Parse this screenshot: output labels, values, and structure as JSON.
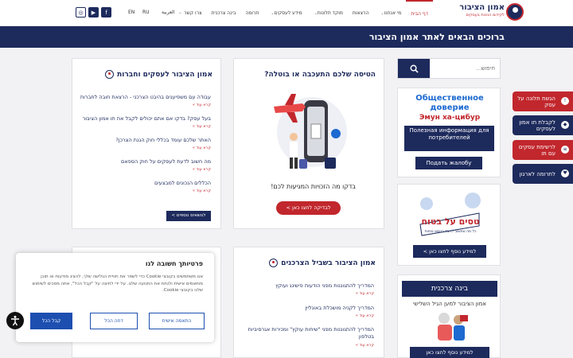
{
  "colors": {
    "navy": "#1d2a5c",
    "red": "#c1272d",
    "blue_button": "#1d4fb0"
  },
  "logo": {
    "title": "אמון הציבור",
    "subtitle": "לקידום הגינות בעסקים"
  },
  "nav": {
    "items": [
      {
        "label": "דף הבית",
        "active": true
      },
      {
        "label": "מי אנחנו",
        "caret": true
      },
      {
        "label": "הרצאות"
      },
      {
        "label": "מוקד תלונות",
        "caret": true
      },
      {
        "label": "מידע לעסקים",
        "caret": true
      },
      {
        "label": "תרומה"
      },
      {
        "label": "בינה צרכנית"
      },
      {
        "label": "צרו קשר"
      }
    ],
    "languages": {
      "arabic": "العربية",
      "russian": "RU",
      "english": "EN"
    },
    "social": {
      "facebook": "f",
      "youtube": "▶",
      "instagram": "◎"
    }
  },
  "banner": {
    "text": "ברוכים הבאים לאתר אמון הציבור"
  },
  "search": {
    "placeholder": "חיפוש...",
    "icon": "search-icon"
  },
  "russian_card": {
    "title": "Общественное доверие",
    "subtitle": "Эмун ха-цибур",
    "info_button": "Полезная информация для потребителей",
    "complaint_button": "Подать жалобу"
  },
  "side_tabs": [
    {
      "label": "הגשת תלונה על עסק",
      "icon": "megaphone-icon",
      "color": "#c1272d"
    },
    {
      "label": "לקבלת תו אמון לעסקים",
      "icon": "shield-icon",
      "color": "#1d2a5c"
    },
    {
      "label": "לרשימת עסקים עם תו",
      "icon": "list-icon",
      "color": "#c1272d"
    },
    {
      "label": "לתרומה לארגון",
      "icon": "heart-icon",
      "color": "#1d2a5c"
    }
  ],
  "flight_card": {
    "title": "הטיסה שלכם התעכבה או בוטלה?",
    "text": "בדקו מה הזכויות המגיעות לכם!",
    "button": "לבדיקה לחצו כאן >"
  },
  "business_card": {
    "title": "אמון הציבור לעסקים וחברות",
    "links": [
      "עבודה עם משפיענים בהיבט הצרכני - הרצאת חובה לחברות",
      "בעל עסק? בדקו אם אתם יכולים לקבל את תו אמון הציבור",
      "האתר שלכם עומד בכללי חוק הגנת הצרכן?",
      "מה חשוב לדעת לעסקים על חוק הספאם",
      "הכללים הנכונים למבצעים"
    ],
    "read_more": "קרא עוד »",
    "more_button": "לנושאים נוספים >"
  },
  "consumer_card": {
    "title": "אמון הציבור בשביל הצרכנים",
    "links": [
      "המדריך להתגוננות מפני הודעות פישינג ועוקץ",
      "המדריך לקניה מושכלת באונליין",
      "המדריך להתגוננות מפני \"שיחות עוקץ\" ומכירות אגרסיביות בטלפון"
    ],
    "read_more": "קרא עוד »"
  },
  "sign_card": {
    "sign_text": "טסים על בטוח",
    "sign_sub": "כל מה שחשוב לדעת בנושא טיסות",
    "button": "למידע נוסף לחצו כאן >"
  },
  "ai_card": {
    "title": "בינה צרכנית",
    "subtitle": "אמון הציבור למען הגיל השלישי",
    "button": "למידע נוסף לחצו כאן"
  },
  "cookie": {
    "title": "פרטיותך חשובה לנו",
    "body": "אנו משתמשים בקובצי Cookie כדי לשפר את חוויית הגלישה שלך, להציג מודעות או תוכן מותאמים אישית ולנתח את התנועה שלנו. על ידי לחיצה על \"קבל הכל\", אתה מסכים לשימוש שלנו בקובצי Cookie.",
    "customize": "התאמה אישית",
    "reject": "דחה הכל",
    "accept": "קבל הכל"
  },
  "accessibility": {
    "icon": "accessibility-icon"
  }
}
